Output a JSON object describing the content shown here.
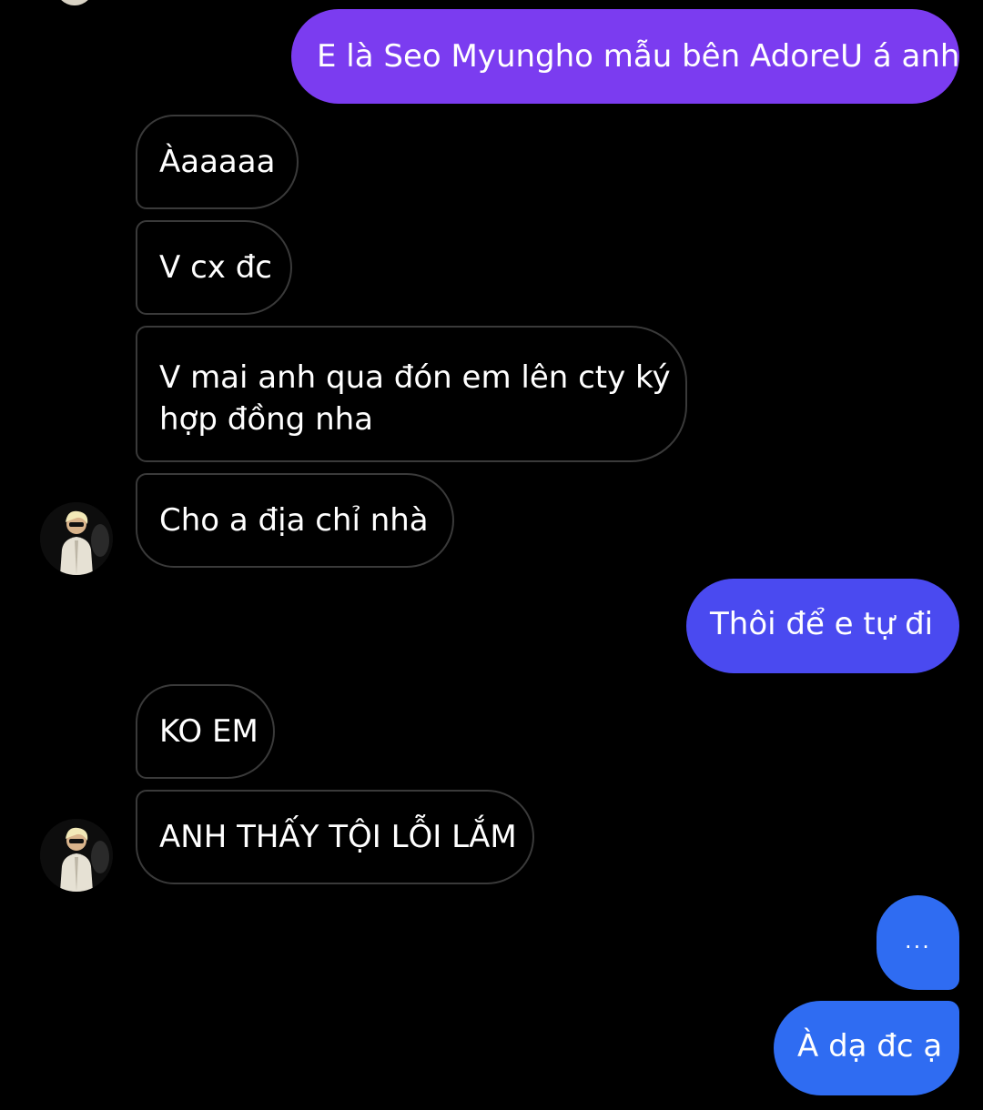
{
  "colors": {
    "sent_gradient_top": "#7b3cf0",
    "sent_gradient_mid": "#4a4af0",
    "sent_gradient_bottom": "#2f6cf2",
    "received_border": "#3a3a3a",
    "background": "#000000"
  },
  "messages": [
    {
      "direction": "sent",
      "text": "E là Seo Myungho mẫu bên AdoreU á anh"
    },
    {
      "direction": "received",
      "text": "Àaaaaa"
    },
    {
      "direction": "received",
      "text": "V cx đc"
    },
    {
      "direction": "received",
      "lines": [
        "V mai anh qua đón em lên cty ký",
        "hợp đồng nha"
      ]
    },
    {
      "direction": "received",
      "text": "Cho a địa chỉ nhà"
    },
    {
      "direction": "sent",
      "text": "Thôi để e tự đi"
    },
    {
      "direction": "received",
      "text": "KO EM"
    },
    {
      "direction": "received",
      "text": "ANH THẤY TỘI LỖI LẮM"
    },
    {
      "direction": "sent",
      "text": "..."
    },
    {
      "direction": "sent",
      "text": "À dạ đc ạ"
    }
  ],
  "avatar": {
    "icon": "contact-avatar-icon"
  }
}
